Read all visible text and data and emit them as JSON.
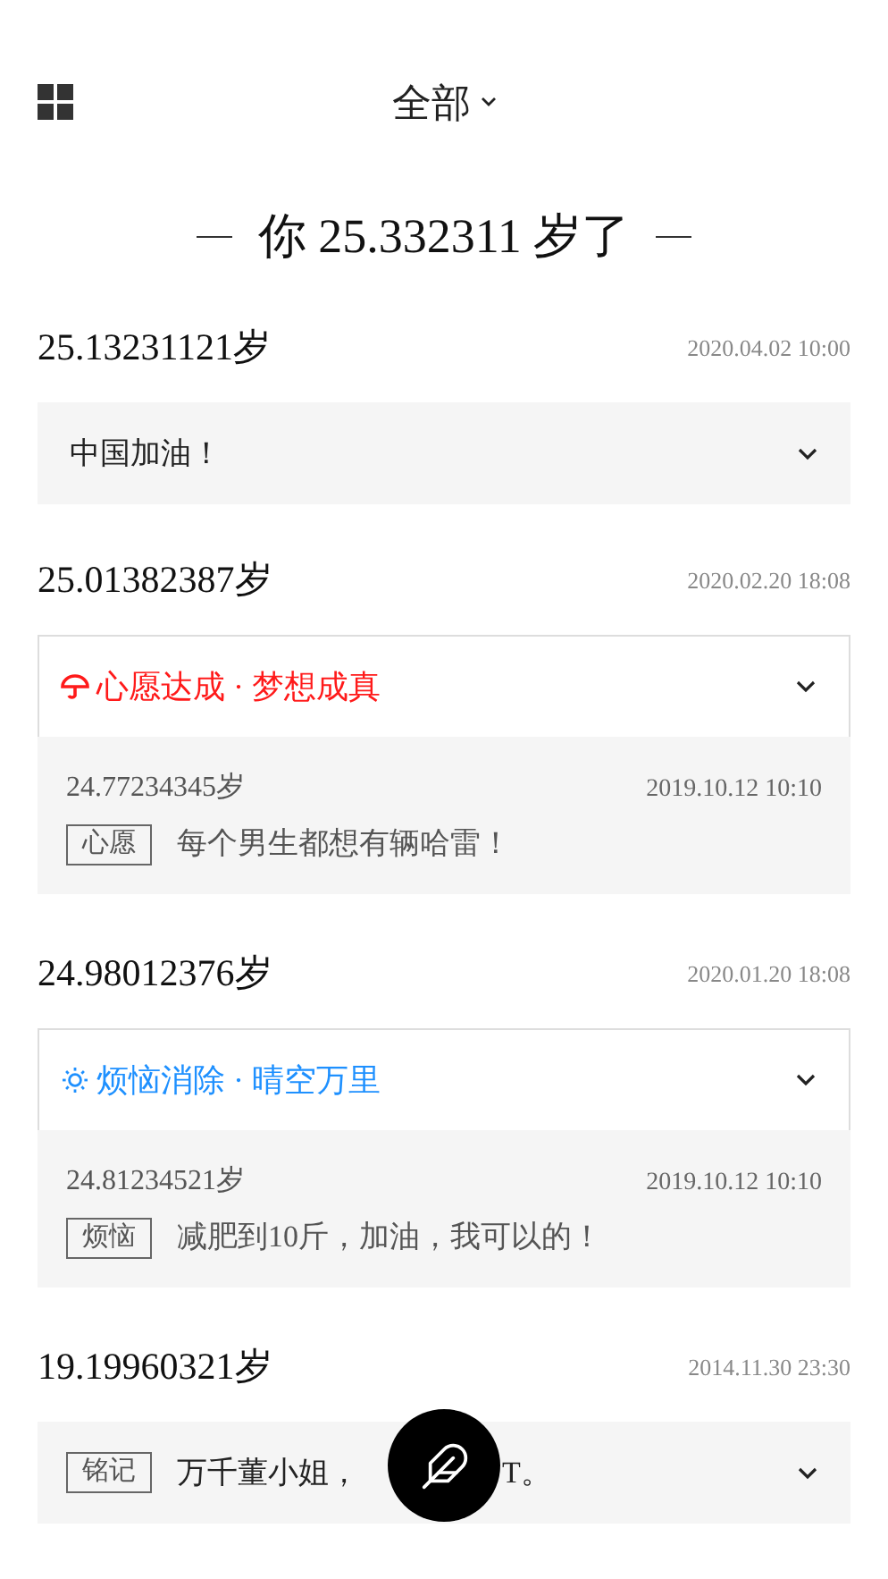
{
  "header": {
    "title": "全部"
  },
  "summary": {
    "prefix": "你",
    "age": "25.332311",
    "suffix": "岁了"
  },
  "entries": [
    {
      "kind": "simple",
      "age": "25.13231121岁",
      "date": "2020.04.02 10:00",
      "text": "中国加油！"
    },
    {
      "kind": "wish",
      "age": "25.01382387岁",
      "date": "2020.02.20 18:08",
      "status": "心愿达成 · 梦想成真",
      "color": "#ff1a1a",
      "memory": {
        "age": "24.77234345岁",
        "date": "2019.10.12 10:10",
        "tag": "心愿",
        "text": "每个男生都想有辆哈雷！"
      }
    },
    {
      "kind": "worry",
      "age": "24.98012376岁",
      "date": "2020.01.20 18:08",
      "status": "烦恼消除 · 晴空万里",
      "color": "#1e90ff",
      "memory": {
        "age": "24.81234521岁",
        "date": "2019.10.12 10:10",
        "tag": "烦恼",
        "text": "减肥到10斤，加油，我可以的！"
      }
    },
    {
      "kind": "tagged",
      "age": "19.19960321岁",
      "date": "2014.11.30 23:30",
      "tag": "铭记",
      "text": "万千董小姐，",
      "text_after": "T。"
    }
  ]
}
